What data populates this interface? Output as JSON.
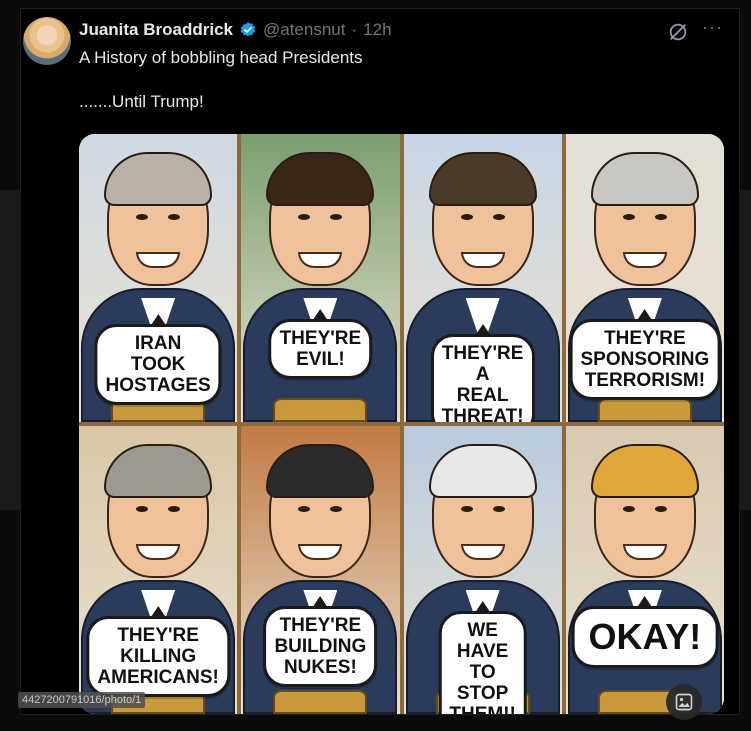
{
  "tweet": {
    "author_name": "Juanita Broaddrick",
    "handle": "@atensnut",
    "separator": "·",
    "time": "12h",
    "more_label": "···",
    "text_line1": "A History of bobbling head Presidents",
    "text_line2": ".......Until Trump!"
  },
  "panels": [
    {
      "bubble": "IRAN TOOK\nHOSTAGES",
      "hair_color": "#b9b2a8",
      "bg": "#cfd9e4"
    },
    {
      "bubble": "THEY'RE\nEVIL!",
      "hair_color": "#3a2618",
      "bg": "#7a9f6f"
    },
    {
      "bubble": "THEY'RE A\nREAL THREAT!",
      "hair_color": "#4a3a2a",
      "bg": "#c8d6e6"
    },
    {
      "bubble": "THEY'RE\nSPONSORING\nTERRORISM!",
      "hair_color": "#c9c7c2",
      "bg": "#e2dfd6"
    },
    {
      "bubble": "THEY'RE KILLING\nAMERICANS!",
      "hair_color": "#9d9890",
      "bg": "#d9c7a6"
    },
    {
      "bubble": "THEY'RE\nBUILDING\nNUKES!",
      "hair_color": "#2a2a2a",
      "bg": "#c27a44"
    },
    {
      "bubble": "WE HAVE TO\nSTOP THEM!!",
      "hair_color": "#e8e8e8",
      "bg": "#b9cbe0"
    },
    {
      "bubble": "OKAY!",
      "hair_color": "#e0a63a",
      "bg": "#d8c9b0"
    }
  ],
  "media_url_overlay": "4427200791016/photo/1",
  "colors": {
    "accent_verified": "#1d9bf0",
    "background": "#000000"
  },
  "icons": [
    "verified-badge-icon",
    "grok-icon",
    "more-icon",
    "alt-text-icon"
  ]
}
